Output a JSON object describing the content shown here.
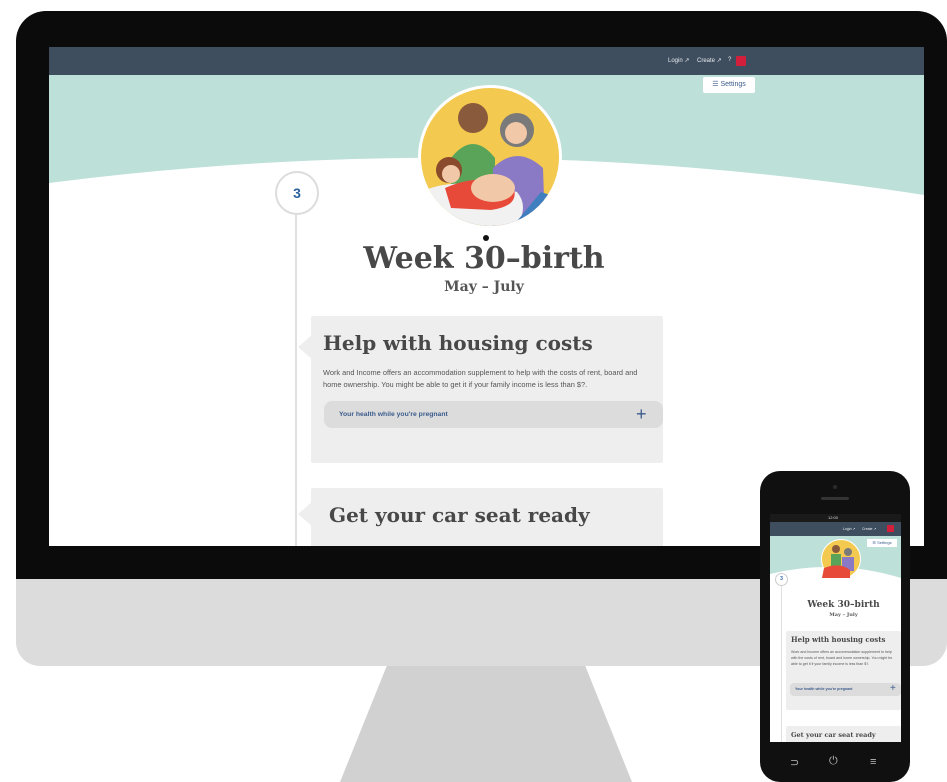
{
  "header": {
    "login_label": "Login ↗",
    "create_label": "Create ↗",
    "help_label": "?",
    "settings_label": "☰ Settings"
  },
  "main": {
    "step_number": "3",
    "title": "Week 30–birth",
    "subtitle": "May – July",
    "cards": [
      {
        "heading": "Help with housing costs",
        "body": "Work and Income offers an accommodation supplement to help with the costs of rent, board and home ownership. You might be able to get it if your family income is less than $?.",
        "accordion_label": "Your health while you're pregnant",
        "accordion_icon": "+"
      },
      {
        "heading": "Get your car seat ready"
      }
    ]
  },
  "phone": {
    "time": "12:00",
    "login_label": "Login ↗",
    "create_label": "Create ↗",
    "settings_label": "☰ Settings",
    "step_number": "3",
    "title": "Week 30–birth",
    "subtitle": "May – July",
    "card_heading": "Help with housing costs",
    "card_body": "Work and Income offers an accommodation supplement to help with the costs of rent, board and home ownership. You might be able to get it if your family income is less than $?.",
    "accordion_label": "Your health while you're pregnant",
    "accordion_icon": "+",
    "card2_heading": "Get your car seat ready",
    "nav_back": "⊃",
    "nav_home": "⏻",
    "nav_menu": "≡"
  },
  "colors": {
    "topbar": "#3f4e5e",
    "hero": "#bde0d9",
    "accent": "#3b5b8c"
  }
}
